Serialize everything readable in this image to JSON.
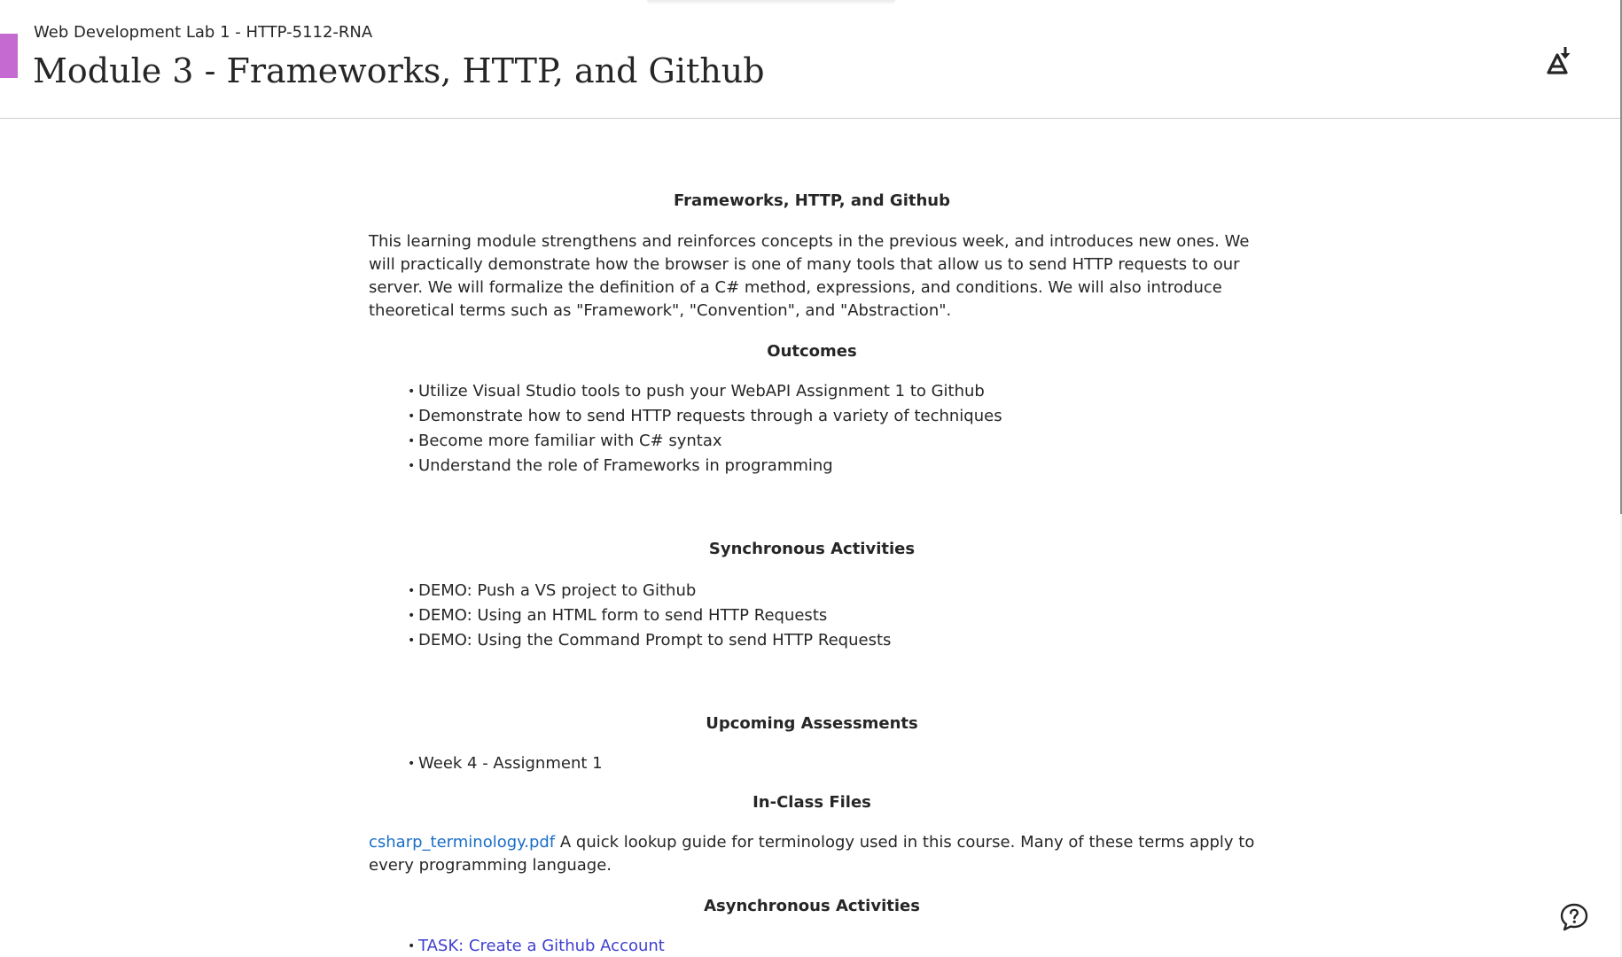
{
  "header": {
    "course_name": "Web Development Lab 1 - HTTP-5112-RNA",
    "module_title": "Module 3 - Frameworks, HTTP, and Github",
    "back_icon": "chevron-left-icon",
    "ally_icon": "ally-alternative-formats-icon"
  },
  "content": {
    "intro_heading": "Frameworks, HTTP, and Github",
    "intro_text": "This learning module strengthens and reinforces concepts in the previous week, and introduces new ones. We will practically demonstrate how the browser is one of many tools that allow us to send HTTP requests to our server. We will formalize the definition of a C# method, expressions, and conditions. We will also introduce theoretical terms such as \"Framework\", \"Convention\", and \"Abstraction\".",
    "outcomes_heading": "Outcomes",
    "outcomes": [
      "Utilize Visual Studio tools to push your WebAPI Assignment 1 to Github",
      "Demonstrate how to send HTTP requests through a variety of techniques",
      "Become more familiar with C# syntax",
      "Understand the role of Frameworks in programming"
    ],
    "sync_heading": "Synchronous Activities",
    "sync_activities": [
      "DEMO: Push a VS project to Github",
      "DEMO: Using an HTML form to send HTTP Requests",
      "DEMO: Using the Command Prompt to send HTTP Requests"
    ],
    "assessments_heading": "Upcoming Assessments",
    "assessments": [
      "Week 4 - Assignment 1"
    ],
    "files_heading": "In-Class Files",
    "file_link": "csharp_terminology.pdf",
    "file_description": " A quick lookup guide for terminology used in this course. Many of these terms apply to every programming language.",
    "async_heading": "Asynchronous Activities",
    "async_first_item": "TASK: Create a Github Account"
  },
  "help": {
    "icon": "help-question-icon"
  },
  "colors": {
    "accent_tab": "#c56ad0",
    "link": "#1a6ec8",
    "text": "#262626"
  }
}
